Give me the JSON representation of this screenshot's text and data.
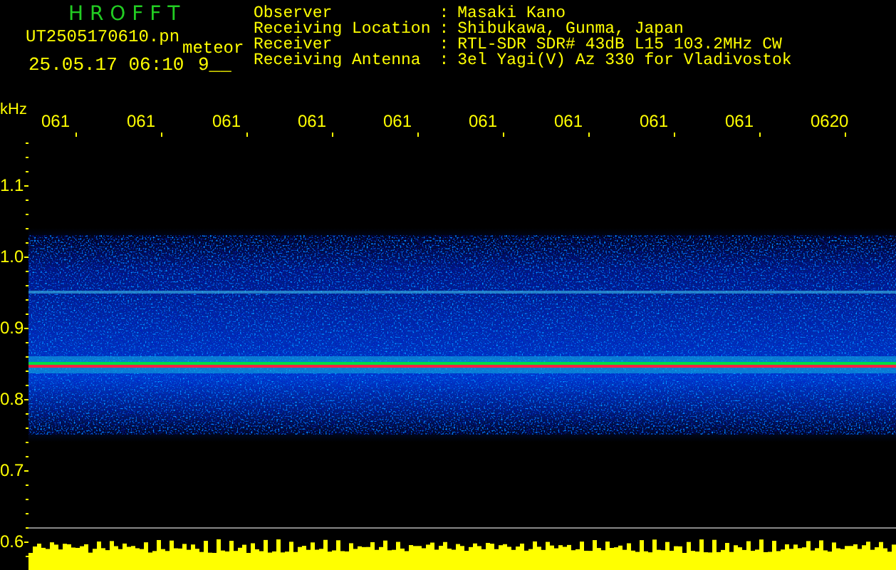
{
  "header": {
    "title": "H R O F F T",
    "filename": "UT2505170610.pn",
    "mode": "meteor",
    "datetime": "25.05.17 06:10",
    "counter": "9__"
  },
  "info": [
    {
      "label": "Observer",
      "separator": ":",
      "value": "Masaki Kano"
    },
    {
      "label": "Receiving Location",
      "separator": ":",
      "value": "Shibukawa, Gunma, Japan"
    },
    {
      "label": "Receiver",
      "separator": ":",
      "value": "RTL-SDR SDR# 43dB L15 103.2MHz CW"
    },
    {
      "label": "Receiving Antenna",
      "separator": ":",
      "value": "3el Yagi(V) Az 330 for Vladivostok"
    }
  ],
  "time_axis": [
    "061",
    "061",
    "061",
    "061",
    "061",
    "061",
    "061",
    "061",
    "061",
    "0620"
  ],
  "freq_axis": {
    "unit": "kHz",
    "labels": [
      "1.1",
      "1.0",
      "0.9",
      "0.8",
      "0.7",
      "0.6"
    ]
  }
}
